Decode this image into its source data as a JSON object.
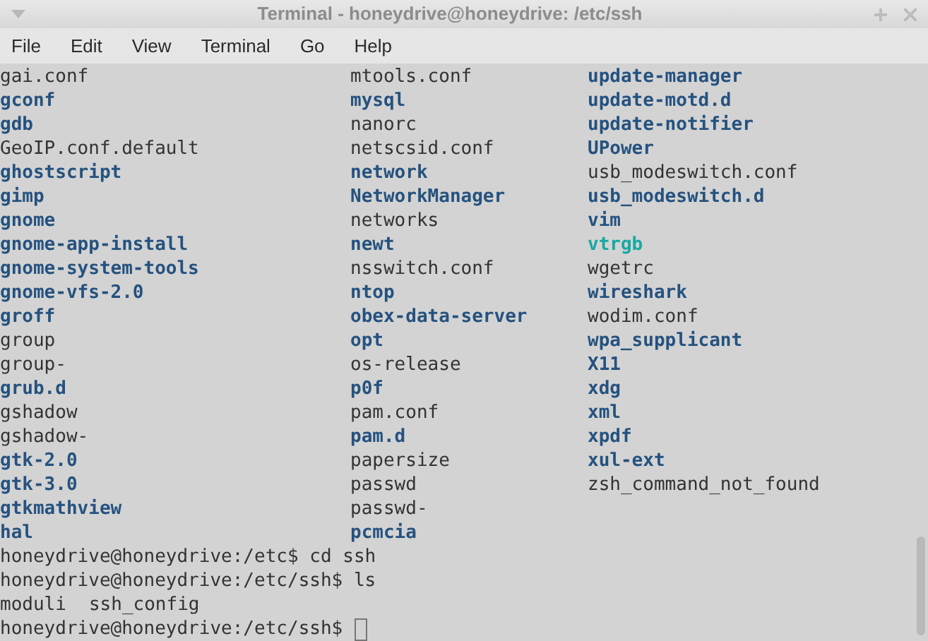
{
  "window": {
    "title": "Terminal - honeydrive@honeydrive: /etc/ssh"
  },
  "menu": [
    "File",
    "Edit",
    "View",
    "Terminal",
    "Go",
    "Help"
  ],
  "listing": [
    [
      {
        "name": "gai.conf",
        "kind": "file"
      },
      {
        "name": "mtools.conf",
        "kind": "file"
      },
      {
        "name": "update-manager",
        "kind": "dir"
      }
    ],
    [
      {
        "name": "gconf",
        "kind": "dir"
      },
      {
        "name": "mysql",
        "kind": "dir"
      },
      {
        "name": "update-motd.d",
        "kind": "dir"
      }
    ],
    [
      {
        "name": "gdb",
        "kind": "dir"
      },
      {
        "name": "nanorc",
        "kind": "file"
      },
      {
        "name": "update-notifier",
        "kind": "dir"
      }
    ],
    [
      {
        "name": "GeoIP.conf.default",
        "kind": "file"
      },
      {
        "name": "netscsid.conf",
        "kind": "file"
      },
      {
        "name": "UPower",
        "kind": "dir"
      }
    ],
    [
      {
        "name": "ghostscript",
        "kind": "dir"
      },
      {
        "name": "network",
        "kind": "dir"
      },
      {
        "name": "usb_modeswitch.conf",
        "kind": "file"
      }
    ],
    [
      {
        "name": "gimp",
        "kind": "dir"
      },
      {
        "name": "NetworkManager",
        "kind": "dir"
      },
      {
        "name": "usb_modeswitch.d",
        "kind": "dir"
      }
    ],
    [
      {
        "name": "gnome",
        "kind": "dir"
      },
      {
        "name": "networks",
        "kind": "file"
      },
      {
        "name": "vim",
        "kind": "dir"
      }
    ],
    [
      {
        "name": "gnome-app-install",
        "kind": "dir"
      },
      {
        "name": "newt",
        "kind": "dir"
      },
      {
        "name": "vtrgb",
        "kind": "link"
      }
    ],
    [
      {
        "name": "gnome-system-tools",
        "kind": "dir"
      },
      {
        "name": "nsswitch.conf",
        "kind": "file"
      },
      {
        "name": "wgetrc",
        "kind": "file"
      }
    ],
    [
      {
        "name": "gnome-vfs-2.0",
        "kind": "dir"
      },
      {
        "name": "ntop",
        "kind": "dir"
      },
      {
        "name": "wireshark",
        "kind": "dir"
      }
    ],
    [
      {
        "name": "groff",
        "kind": "dir"
      },
      {
        "name": "obex-data-server",
        "kind": "dir"
      },
      {
        "name": "wodim.conf",
        "kind": "file"
      }
    ],
    [
      {
        "name": "group",
        "kind": "file"
      },
      {
        "name": "opt",
        "kind": "dir"
      },
      {
        "name": "wpa_supplicant",
        "kind": "dir"
      }
    ],
    [
      {
        "name": "group-",
        "kind": "file"
      },
      {
        "name": "os-release",
        "kind": "file"
      },
      {
        "name": "X11",
        "kind": "dir"
      }
    ],
    [
      {
        "name": "grub.d",
        "kind": "dir"
      },
      {
        "name": "p0f",
        "kind": "dir"
      },
      {
        "name": "xdg",
        "kind": "dir"
      }
    ],
    [
      {
        "name": "gshadow",
        "kind": "file"
      },
      {
        "name": "pam.conf",
        "kind": "file"
      },
      {
        "name": "xml",
        "kind": "dir"
      }
    ],
    [
      {
        "name": "gshadow-",
        "kind": "file"
      },
      {
        "name": "pam.d",
        "kind": "dir"
      },
      {
        "name": "xpdf",
        "kind": "dir"
      }
    ],
    [
      {
        "name": "gtk-2.0",
        "kind": "dir"
      },
      {
        "name": "papersize",
        "kind": "file"
      },
      {
        "name": "xul-ext",
        "kind": "dir"
      }
    ],
    [
      {
        "name": "gtk-3.0",
        "kind": "dir"
      },
      {
        "name": "passwd",
        "kind": "file"
      },
      {
        "name": "zsh_command_not_found",
        "kind": "file"
      }
    ],
    [
      {
        "name": "gtkmathview",
        "kind": "dir"
      },
      {
        "name": "passwd-",
        "kind": "file"
      }
    ],
    [
      {
        "name": "hal",
        "kind": "dir"
      },
      {
        "name": "pcmcia",
        "kind": "dir"
      }
    ]
  ],
  "lines": [
    "honeydrive@honeydrive:/etc$ cd ssh",
    "honeydrive@honeydrive:/etc/ssh$ ls"
  ],
  "ls_output": [
    {
      "name": "moduli",
      "kind": "file"
    },
    {
      "name": "ssh_config",
      "kind": "file"
    }
  ],
  "prompt": "honeydrive@honeydrive:/etc/ssh$"
}
